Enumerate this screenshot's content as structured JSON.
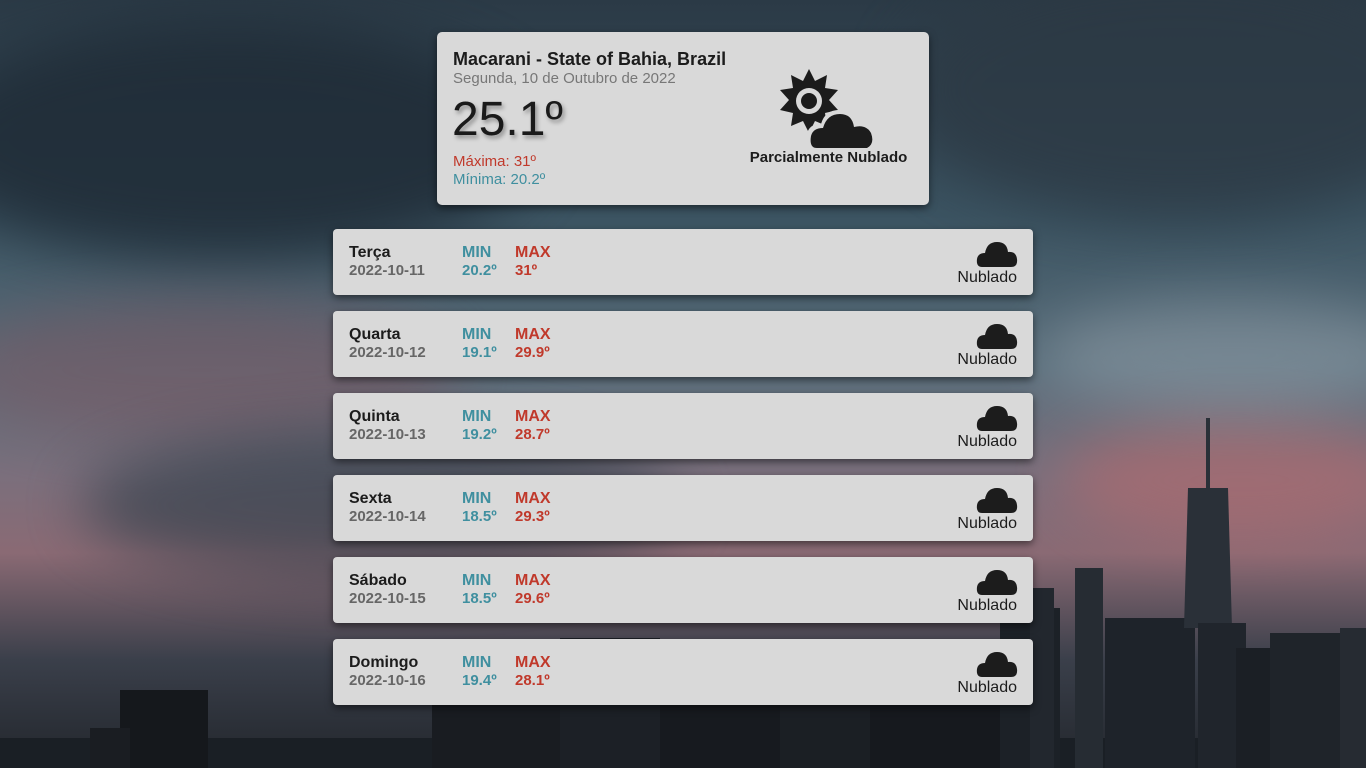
{
  "current": {
    "location": "Macarani - State of Bahia, Brazil",
    "date": "Segunda, 10 de Outubro de 2022",
    "temperature": "25.1º",
    "max": "Máxima: 31º",
    "min": "Mínima: 20.2º",
    "condition": "Parcialmente Nublado",
    "icon": "partly-cloudy-icon"
  },
  "forecast": [
    {
      "day": "Terça",
      "date": "2022-10-11",
      "min_label": "MIN",
      "min": "20.2º",
      "max_label": "MAX",
      "max": "31º",
      "condition": "Nublado",
      "icon": "cloud-icon"
    },
    {
      "day": "Quarta",
      "date": "2022-10-12",
      "min_label": "MIN",
      "min": "19.1º",
      "max_label": "MAX",
      "max": "29.9º",
      "condition": "Nublado",
      "icon": "cloud-icon"
    },
    {
      "day": "Quinta",
      "date": "2022-10-13",
      "min_label": "MIN",
      "min": "19.2º",
      "max_label": "MAX",
      "max": "28.7º",
      "condition": "Nublado",
      "icon": "cloud-icon"
    },
    {
      "day": "Sexta",
      "date": "2022-10-14",
      "min_label": "MIN",
      "min": "18.5º",
      "max_label": "MAX",
      "max": "29.3º",
      "condition": "Nublado",
      "icon": "cloud-icon"
    },
    {
      "day": "Sábado",
      "date": "2022-10-15",
      "min_label": "MIN",
      "min": "18.5º",
      "max_label": "MAX",
      "max": "29.6º",
      "condition": "Nublado",
      "icon": "cloud-icon"
    },
    {
      "day": "Domingo",
      "date": "2022-10-16",
      "min_label": "MIN",
      "min": "19.4º",
      "max_label": "MAX",
      "max": "28.1º",
      "condition": "Nublado",
      "icon": "cloud-icon"
    }
  ],
  "colors": {
    "min": "#3f8f9f",
    "max": "#c0392b",
    "card": "#d9d9d9"
  }
}
